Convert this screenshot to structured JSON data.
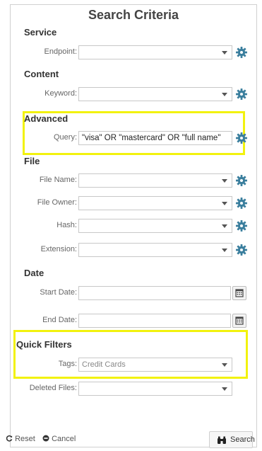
{
  "title": "Search Criteria",
  "sections": {
    "service": "Service",
    "content": "Content",
    "advanced": "Advanced",
    "file": "File",
    "date": "Date",
    "quick_filters": "Quick Filters"
  },
  "fields": {
    "endpoint": {
      "label": "Endpoint:",
      "value": ""
    },
    "keyword": {
      "label": "Keyword:",
      "value": ""
    },
    "query": {
      "label": "Query:",
      "value": "\"visa\" OR \"mastercard\" OR \"full name\""
    },
    "file_name": {
      "label": "File Name:",
      "value": ""
    },
    "file_owner": {
      "label": "File Owner:",
      "value": ""
    },
    "hash": {
      "label": "Hash:",
      "value": ""
    },
    "extension": {
      "label": "Extension:",
      "value": ""
    },
    "start_date": {
      "label": "Start Date:",
      "value": ""
    },
    "end_date": {
      "label": "End Date:",
      "value": ""
    },
    "tags": {
      "label": "Tags:",
      "value": "Credit Cards"
    },
    "deleted_files": {
      "label": "Deleted Files:",
      "value": ""
    }
  },
  "footer": {
    "reset_label": "Reset",
    "cancel_label": "Cancel",
    "search_label": "Search"
  },
  "colors": {
    "gear": "#3b7f9e",
    "highlight": "#f2f20e"
  },
  "icons": [
    "gear-icon",
    "calendar-icon",
    "reset-icon",
    "cancel-icon",
    "binoculars-icon",
    "chevron-down-icon"
  ]
}
